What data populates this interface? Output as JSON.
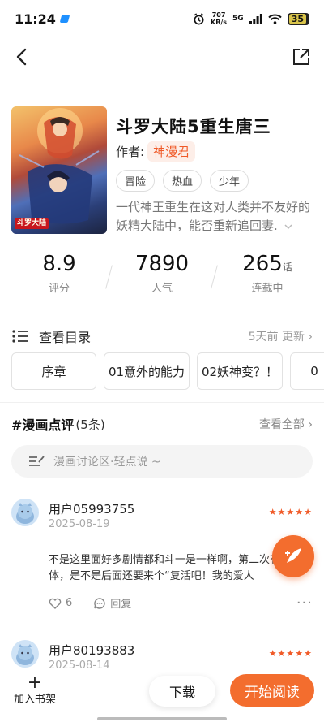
{
  "status_bar": {
    "time": "11:24",
    "net_speed": "707",
    "net_unit": "KB/s",
    "signal": "5G",
    "battery": "35"
  },
  "book": {
    "title": "斗罗大陆5重生唐三",
    "author_label": "作者:",
    "author": "神漫君",
    "tags": [
      "冒险",
      "热血",
      "少年"
    ],
    "description": "一代神王重生在这对人类并不友好的妖精大陆中，能否重新追回妻.",
    "cover_badge": "斗罗大陆"
  },
  "stats": [
    {
      "value": "8.9",
      "unit": "",
      "label": "评分"
    },
    {
      "value": "7890",
      "unit": "",
      "label": "人气"
    },
    {
      "value": "265",
      "unit": "话",
      "label": "连载中"
    }
  ],
  "catalog": {
    "label": "查看目录",
    "update": "5天前 更新 ›",
    "chapters": [
      "序章",
      "01意外的能力",
      "02妖神变？！",
      "0"
    ]
  },
  "reviews": {
    "title": "#漫画点评",
    "count": "(5条)",
    "view_all": "查看全部 ›",
    "discuss_placeholder": "漫画讨论区·轻点说 ~",
    "items": [
      {
        "user": "用户05993755",
        "date": "2025-08-19",
        "stars": "★★★★★",
        "text": "不是这里面好多剧情都和斗一是一样啊，第二次有冰火连体，是不是后面还要来个“复活吧！我的爱人",
        "likes": "6",
        "reply_label": "回复",
        "more": "···"
      },
      {
        "user": "用户80193883",
        "date": "2025-08-14",
        "stars": "★★★★★"
      }
    ]
  },
  "bottom_bar": {
    "add_shelf_icon": "+",
    "add_shelf": "加入书架",
    "download": "下载",
    "read": "开始阅读"
  },
  "colors": {
    "accent": "#f36d2e",
    "star": "#f05a28"
  }
}
